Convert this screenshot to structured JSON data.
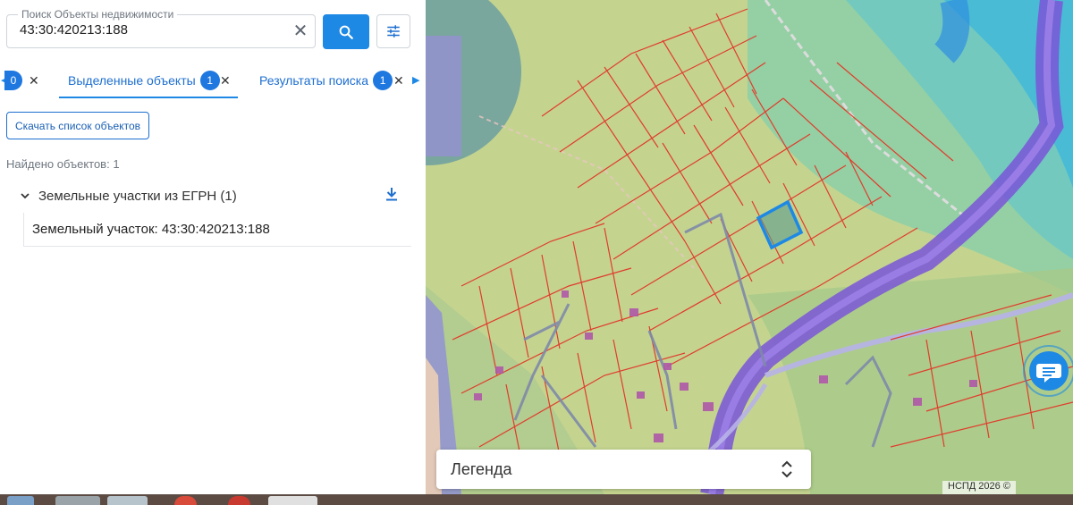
{
  "search": {
    "label": "Поиск Объекты недвижимости",
    "value": "43:30:420213:188"
  },
  "tabs": [
    {
      "label": "",
      "badge": "0"
    },
    {
      "label": "Выделенные объекты",
      "badge": "1"
    },
    {
      "label": "Результаты поиска",
      "badge": "1"
    }
  ],
  "actions": {
    "download_list": "Скачать список объектов"
  },
  "results": {
    "found": "Найдено объектов: 1",
    "group_title": "Земельные участки из ЕГРН (1)",
    "item": "Земельный участок: 43:30:420213:188"
  },
  "map": {
    "legend_title": "Легенда",
    "attribution": "НСПД 2026 ©",
    "selected_parcel_color": "#1e88e5",
    "parcel_border_color": "#e03c2c"
  },
  "icons": {
    "search": "search-icon",
    "clear": "close-icon",
    "filter": "tune-icon",
    "download": "download-icon",
    "chat": "chat-icon",
    "legend_toggle": "unfold-icon"
  }
}
